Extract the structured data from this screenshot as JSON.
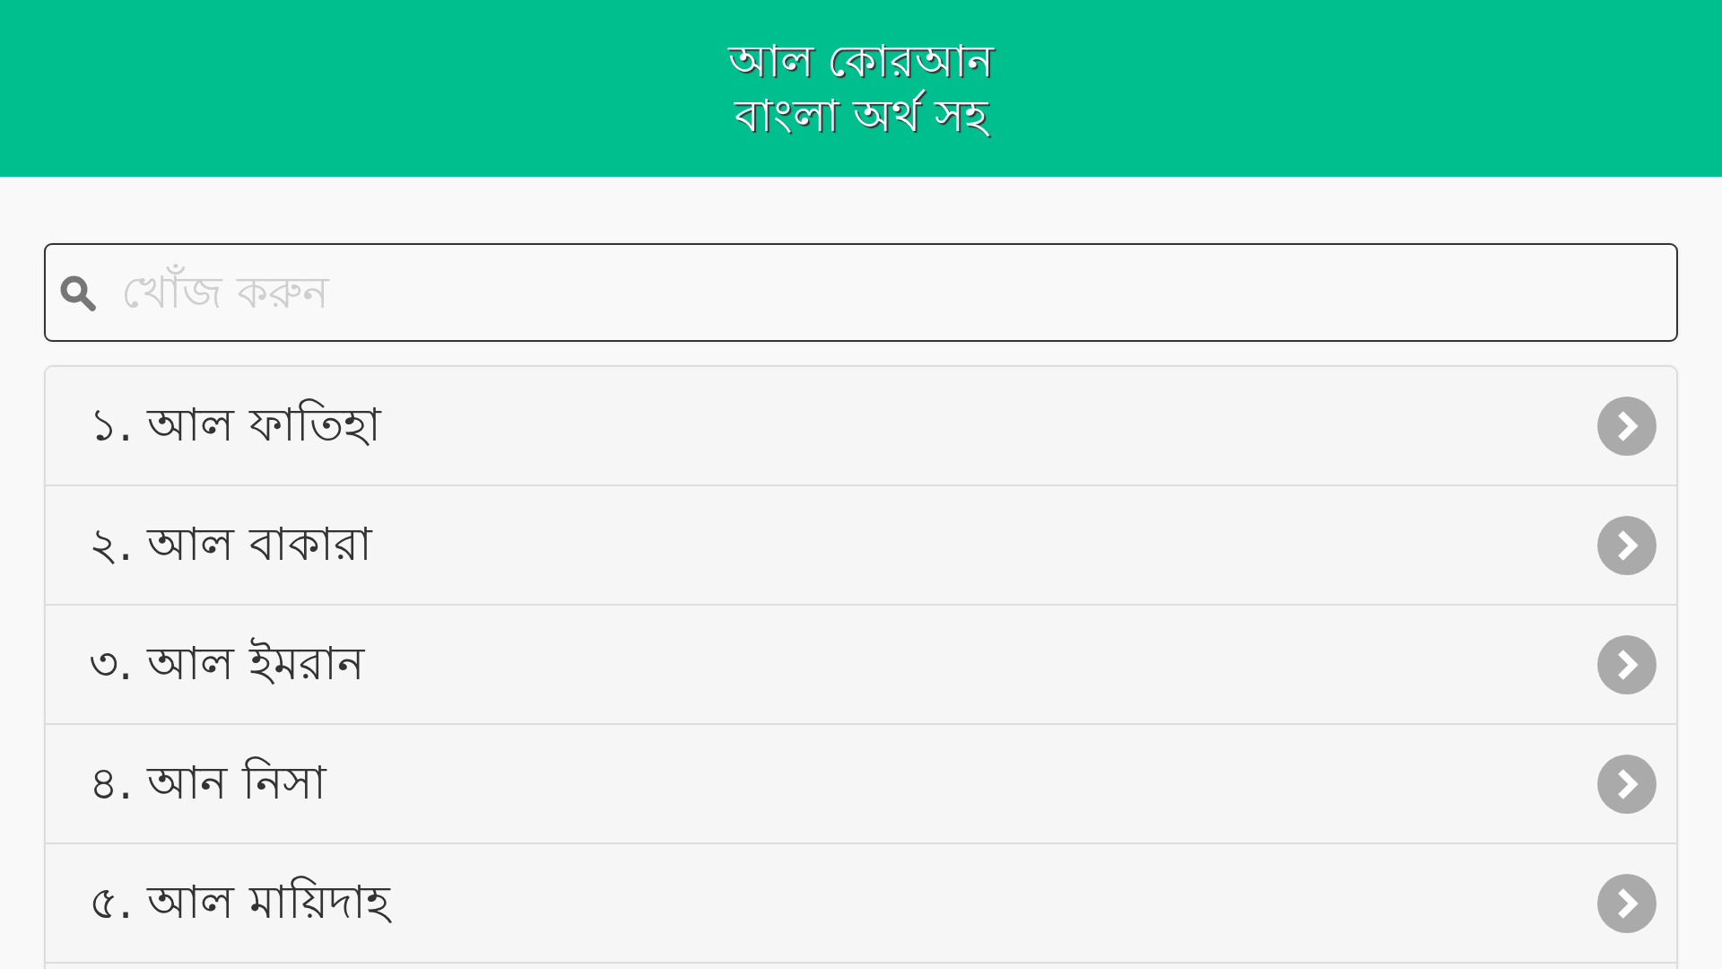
{
  "header": {
    "title": "আল কোরআন",
    "subtitle": "বাংলা অর্থ সহ"
  },
  "search": {
    "placeholder": "খোঁজ করুন"
  },
  "surahs": [
    {
      "label": "১. আল ফাতিহা"
    },
    {
      "label": "২. আল বাকারা"
    },
    {
      "label": "৩. আল ইমরান"
    },
    {
      "label": "৪. আন নিসা"
    },
    {
      "label": "৫. আল মায়িদাহ"
    }
  ]
}
